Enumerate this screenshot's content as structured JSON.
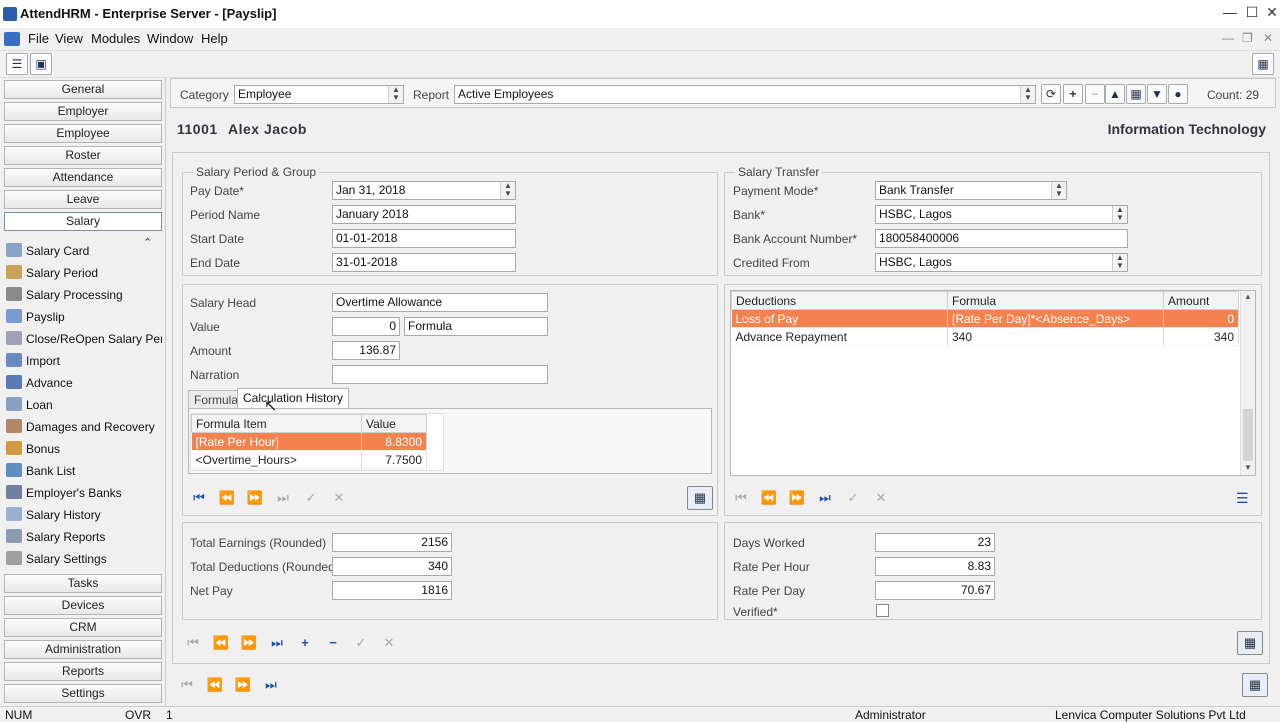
{
  "window": {
    "title": "AttendHRM - Enterprise Server - [Payslip]"
  },
  "menu": [
    "File",
    "View",
    "Modules",
    "Window",
    "Help"
  ],
  "nav": {
    "sections_top": [
      "General",
      "Employer",
      "Employee",
      "Roster",
      "Attendance",
      "Leave",
      "Salary"
    ],
    "salary_items": [
      "Salary Card",
      "Salary Period",
      "Salary Processing",
      "Payslip",
      "Close/ReOpen Salary Per…",
      "Import",
      "Advance",
      "Loan",
      "Damages and Recovery",
      "Bonus",
      "Bank List",
      "Employer's Banks",
      "Salary History",
      "Salary Reports",
      "Salary Settings"
    ],
    "sections_bottom": [
      "Tasks",
      "Devices",
      "CRM",
      "Administration",
      "Reports",
      "Settings"
    ]
  },
  "filter": {
    "category_label": "Category",
    "category_value": "Employee",
    "report_label": "Report",
    "report_value": "Active Employees",
    "count": "Count: 29"
  },
  "employee": {
    "id": "11001",
    "name": "Alex Jacob",
    "department": "Information Technology"
  },
  "salary_period": {
    "title": "Salary Period & Group",
    "pay_date_label": "Pay Date*",
    "pay_date": "Jan 31, 2018",
    "period_name_label": "Period Name",
    "period_name": "January 2018",
    "start_date_label": "Start Date",
    "start_date": "01-01-2018",
    "end_date_label": "End Date",
    "end_date": "31-01-2018"
  },
  "salary_transfer": {
    "title": "Salary Transfer",
    "payment_mode_label": "Payment Mode*",
    "payment_mode": "Bank Transfer",
    "bank_label": "Bank*",
    "bank": "HSBC, Lagos",
    "account_label": "Bank Account Number*",
    "account": "180058400006",
    "credited_from_label": "Credited From",
    "credited_from": "HSBC, Lagos"
  },
  "salary_head": {
    "head_label": "Salary Head",
    "head": "Overtime Allowance",
    "value_label": "Value",
    "value": "0",
    "value_type": "Formula",
    "amount_label": "Amount",
    "amount": "136.87",
    "narration_label": "Narration",
    "narration": "",
    "tabs": [
      "Formula",
      "Calculation History"
    ],
    "history_headers": [
      "Formula Item",
      "Value"
    ],
    "history_rows": [
      [
        "[Rate Per Hour]",
        "8.8300"
      ],
      [
        "<Overtime_Hours>",
        "7.7500"
      ]
    ]
  },
  "deductions": {
    "headers": [
      "Deductions",
      "Formula",
      "Amount"
    ],
    "rows": [
      [
        "Loss of Pay",
        "[Rate Per Day]*<Absence_Days>",
        "0"
      ],
      [
        "Advance Repayment",
        "340",
        "340"
      ]
    ]
  },
  "totals": {
    "earnings_label": "Total Earnings (Rounded)",
    "earnings": "2156",
    "deductions_label": "Total Deductions (Rounded)",
    "deductions": "340",
    "net_label": "Net Pay",
    "net": "1816",
    "days_worked_label": "Days Worked",
    "days_worked": "23",
    "rate_hour_label": "Rate Per Hour",
    "rate_hour": "8.83",
    "rate_day_label": "Rate Per Day",
    "rate_day": "70.67",
    "verified_label": "Verified*"
  },
  "status": {
    "num": "NUM",
    "ovr": "OVR",
    "page": "1",
    "user": "Administrator",
    "company": "Lenvica Computer Solutions Pvt Ltd"
  },
  "colors": {
    "highlight": "#f4824f",
    "nav_blue": "#1a4fb0"
  }
}
